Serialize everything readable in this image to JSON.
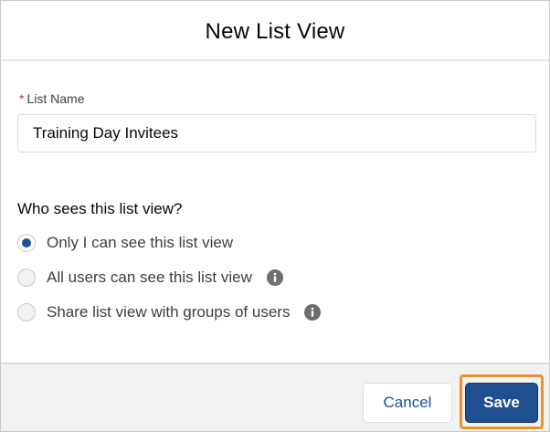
{
  "modal": {
    "title": "New List View"
  },
  "list_name": {
    "required_marker": "*",
    "label": "List Name",
    "value": "Training Day Invitees"
  },
  "visibility": {
    "legend": "Who sees this list view?",
    "selected": "only_me",
    "options": [
      {
        "id": "only_me",
        "label": "Only I can see this list view",
        "checked": true,
        "info_icon": false
      },
      {
        "id": "all_users",
        "label": "All users can see this list view",
        "checked": false,
        "info_icon": true
      },
      {
        "id": "groups",
        "label": "Share list view with groups of users",
        "checked": false,
        "info_icon": true
      }
    ]
  },
  "footer": {
    "cancel_label": "Cancel",
    "save_label": "Save"
  },
  "colors": {
    "brand_blue": "#1f4f8f",
    "radio_selected": "#1b5297",
    "required_red": "#c23934",
    "highlight_orange": "#e8932f",
    "info_icon_gray": "#706e6b"
  },
  "icons": {
    "info": "info-icon"
  }
}
